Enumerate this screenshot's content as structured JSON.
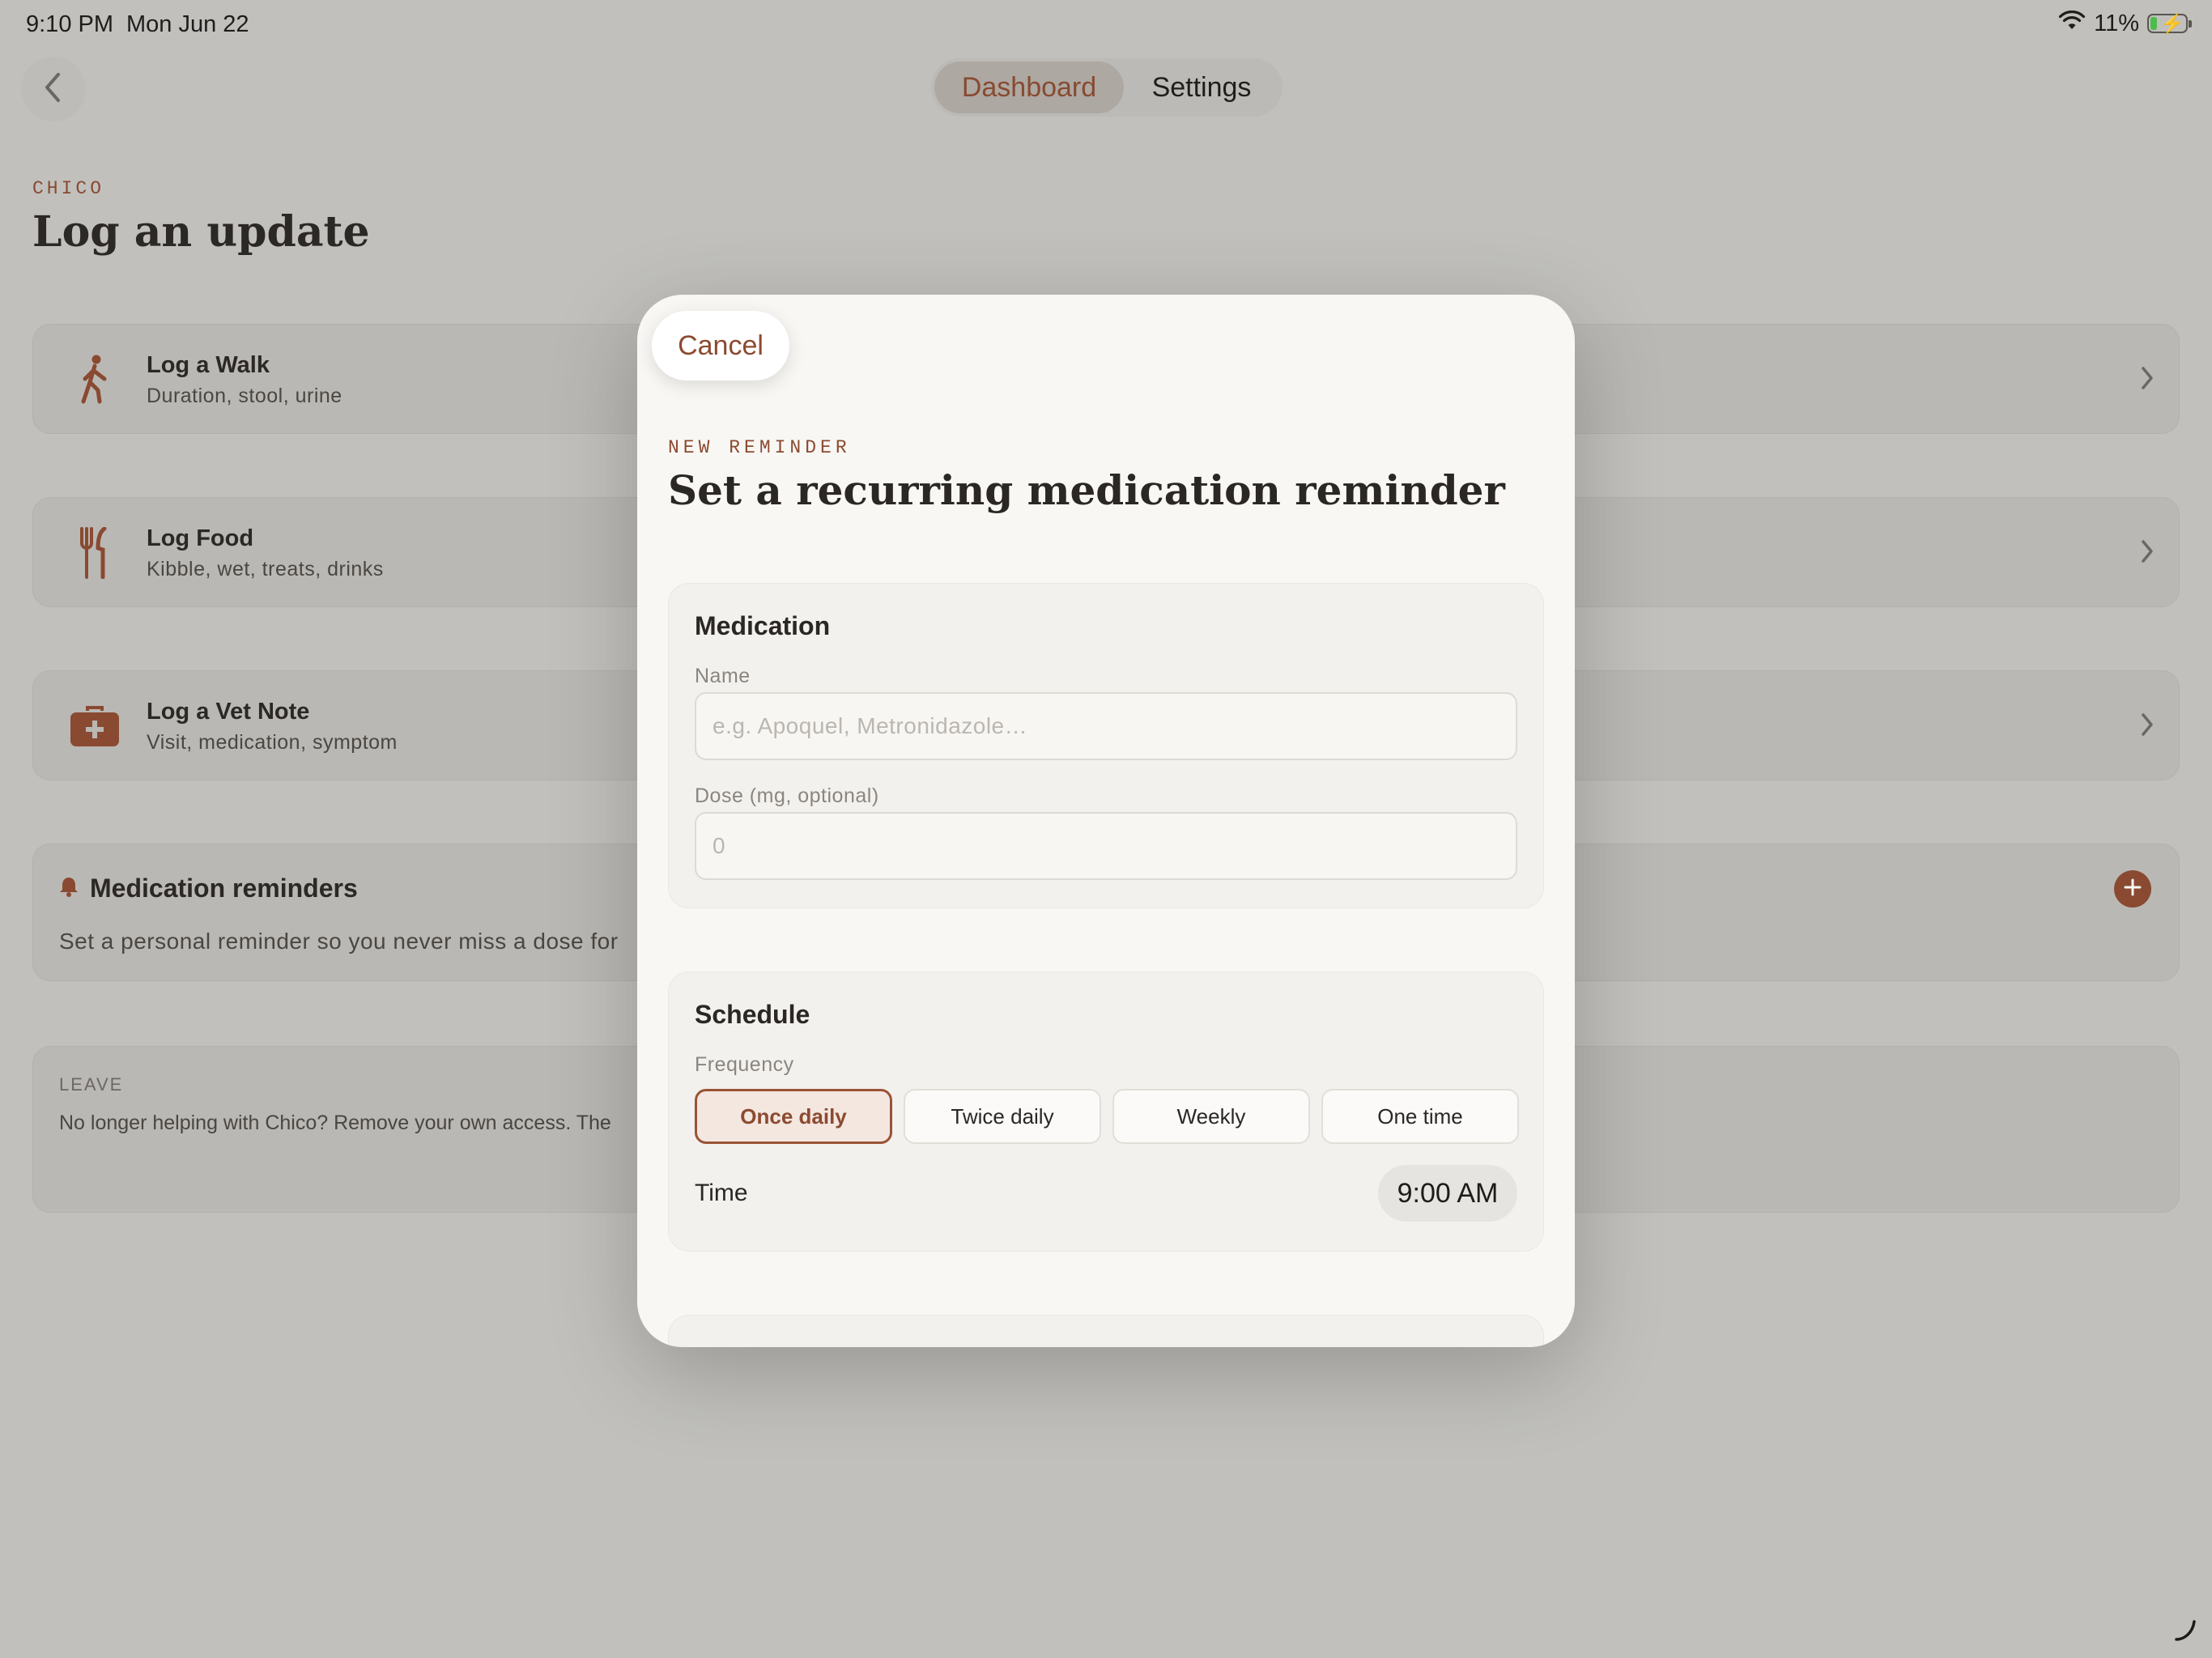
{
  "status_bar": {
    "time": "9:10 PM",
    "date": "Mon Jun 22",
    "battery": "11%",
    "battery_level": 0.11,
    "icons": [
      "wifi-icon",
      "battery-charging-icon"
    ]
  },
  "nav": {
    "tabs": [
      {
        "label": "Dashboard",
        "active": true
      },
      {
        "label": "Settings",
        "active": false
      }
    ],
    "back_icon": "chevron-left-icon"
  },
  "header": {
    "pet_name": "CHICO",
    "title": "Log an update"
  },
  "log_rows": [
    {
      "title": "Log a Walk",
      "subtitle": "Duration, stool, urine",
      "icon": "walking-person-icon"
    },
    {
      "title": "Log Food",
      "subtitle": "Kibble, wet, treats, drinks",
      "icon": "fork-knife-icon"
    },
    {
      "title": "Log a Vet Note",
      "subtitle": "Visit, medication, symptom",
      "icon": "medical-kit-icon"
    }
  ],
  "reminders_card": {
    "title": "Medication reminders",
    "description": "Set a personal reminder so you never miss a dose for",
    "add_icon": "plus-circle-icon"
  },
  "leave_card": {
    "label": "LEAVE",
    "description": "No longer helping with Chico? Remove your own access. The"
  },
  "modal": {
    "cancel": "Cancel",
    "eyebrow": "NEW REMINDER",
    "title": "Set a recurring medication reminder",
    "medication": {
      "section_title": "Medication",
      "name_label": "Name",
      "name_placeholder": "e.g. Apoquel, Metronidazole…",
      "name_value": "",
      "dose_label": "Dose (mg, optional)",
      "dose_placeholder": "0",
      "dose_value": ""
    },
    "schedule": {
      "section_title": "Schedule",
      "frequency_label": "Frequency",
      "options": [
        "Once daily",
        "Twice daily",
        "Weekly",
        "One time"
      ],
      "selected": "Once daily",
      "time_label": "Time",
      "time_value": "9:00 AM"
    }
  },
  "colors": {
    "accent": "#8c4a30",
    "background": "#c6c5c2",
    "modal": "#f8f7f4"
  }
}
